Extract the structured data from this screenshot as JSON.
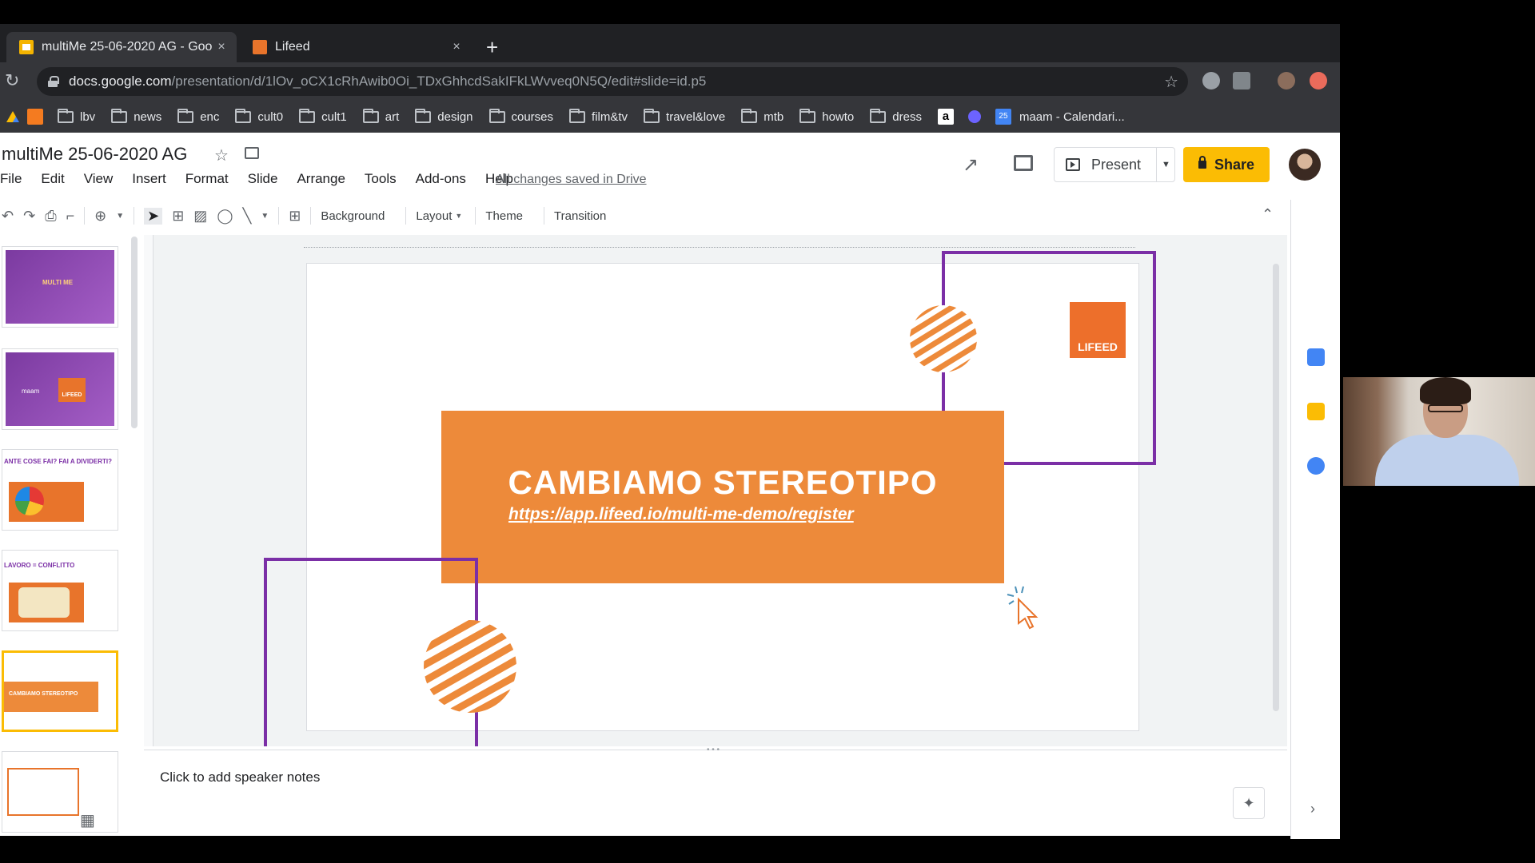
{
  "browser": {
    "tabs": [
      {
        "title": "multiMe 25-06-2020 AG - Goo",
        "close": "×",
        "active": true
      },
      {
        "title": "Lifeed",
        "close": "×",
        "active": false
      }
    ],
    "new_tab": "+",
    "url_host": "docs.google.com",
    "url_path": "/presentation/d/1lOv_oCX1cRhAwib0Oi_TDxGhhcdSakIFkLWvveq0N5Q/edit#slide=id.p5",
    "bookmarks": [
      "lbv",
      "news",
      "enc",
      "cult0",
      "cult1",
      "art",
      "design",
      "courses",
      "film&tv",
      "travel&love",
      "mtb",
      "howto",
      "dress"
    ],
    "calendar_bookmark": "maam - Calendari...",
    "calendar_badge": "25"
  },
  "doc": {
    "title": "multiMe 25-06-2020 AG",
    "menu": [
      "File",
      "Edit",
      "View",
      "Insert",
      "Format",
      "Slide",
      "Arrange",
      "Tools",
      "Add-ons",
      "Help"
    ],
    "saved_status": "All changes saved in Drive",
    "present_label": "Present",
    "share_label": "Share"
  },
  "editbar": {
    "background": "Background",
    "layout": "Layout",
    "theme": "Theme",
    "transition": "Transition"
  },
  "filmstrip": [
    {
      "title": "MULTI ME"
    },
    {
      "title": "maam",
      "logo": "LIFEED"
    },
    {
      "title": "ANTE COSE FAI? FAI A DIVIDERTI?"
    },
    {
      "title": "LAVORO = CONFLITTO"
    },
    {
      "title": "CAMBIAMO STEREOTIPO",
      "selected": true
    },
    {
      "title": ""
    }
  ],
  "slide": {
    "heading": "CAMBIAMO STEREOTIPO",
    "link": "https://app.lifeed.io/multi-me-demo/register",
    "logo_text": "LIFEED"
  },
  "notes": {
    "placeholder": "Click to add speaker notes"
  },
  "colors": {
    "orange": "#ed8a3a",
    "purple": "#7b2fa6",
    "share_yellow": "#fbbc04"
  }
}
